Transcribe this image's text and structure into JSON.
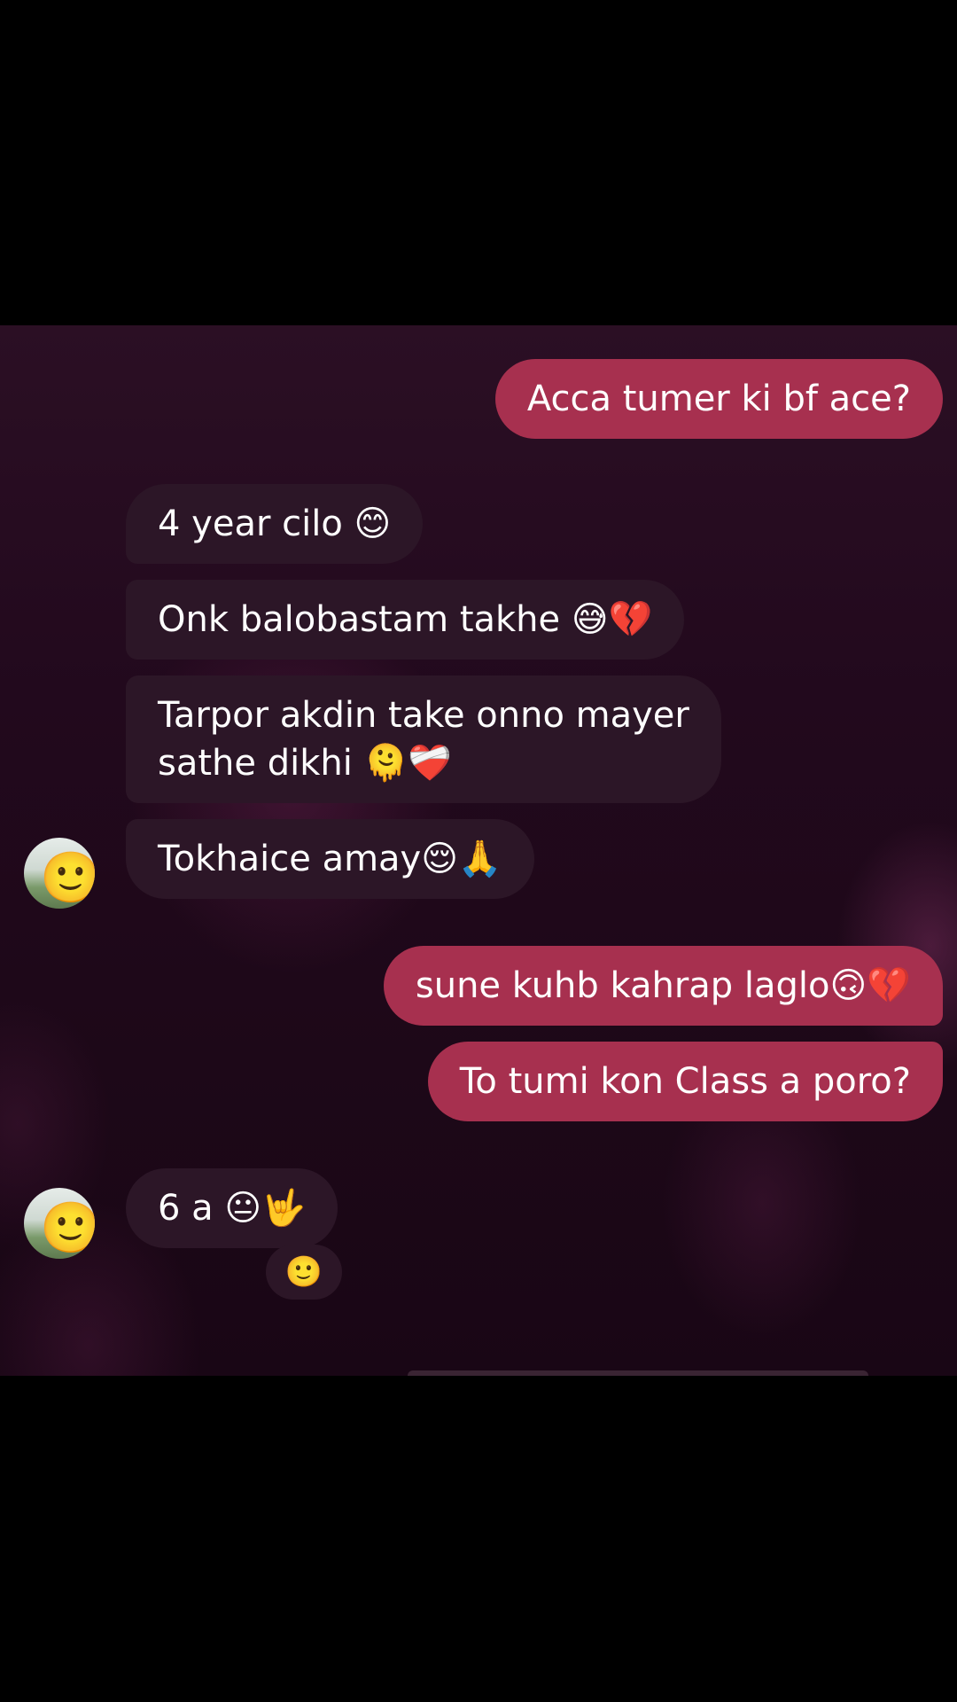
{
  "messages": [
    {
      "id": "m1",
      "direction": "outgoing",
      "text": "Acca tumer ki bf ace?"
    },
    {
      "id": "m2",
      "direction": "incoming",
      "text": "4 year cilo 😊"
    },
    {
      "id": "m3",
      "direction": "incoming",
      "text": "Onk balobastam takhe 😅💔"
    },
    {
      "id": "m4",
      "direction": "incoming",
      "line1": "Tarpor akdin take onno mayer",
      "line2": "sathe dikhi 🫠❤️‍🩹"
    },
    {
      "id": "m5",
      "direction": "incoming",
      "text": "Tokhaice amay😌🙏"
    },
    {
      "id": "m6",
      "direction": "outgoing",
      "text": "sune kuhb kahrap laglo🙃💔"
    },
    {
      "id": "m7",
      "direction": "outgoing",
      "text": "To tumi kon Class a poro?"
    },
    {
      "id": "m8",
      "direction": "incoming",
      "text": "6 a 😐🤟"
    }
  ],
  "reaction": {
    "emoji": "🙂"
  },
  "avatar": {
    "emoji": "🙂"
  },
  "colors": {
    "outgoing_bubble": "#a7304f",
    "incoming_bubble": "#2c1627",
    "background": "#22091d",
    "text": "#ffffff"
  }
}
